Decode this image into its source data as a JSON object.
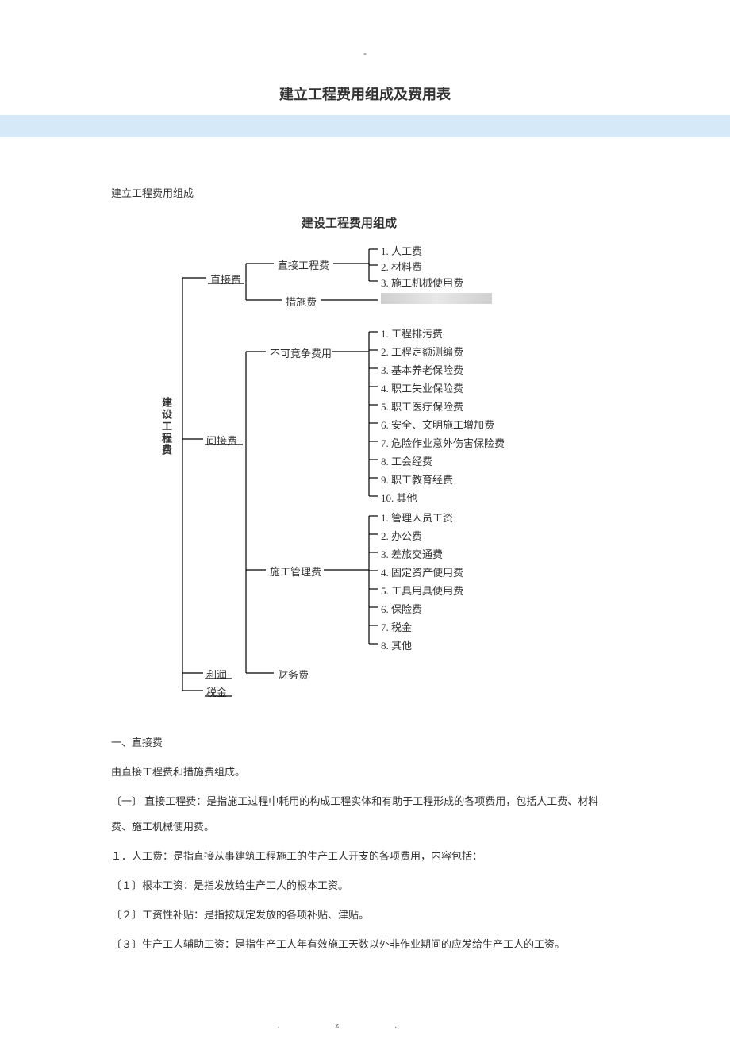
{
  "dash": "-",
  "title": "建立工程费用组成及费用表",
  "sub1": "建立工程费用组成",
  "diagram": {
    "heading": "建设工程费用组成",
    "root": "建设工程费",
    "branches": {
      "zhijie_fei": "直接费",
      "zhijie_gongcheng": "直接工程费",
      "cuoshi": "措施费",
      "jianjie": "间接费",
      "bukejing": "不可竞争费用",
      "shigong_guanli": "施工管理费",
      "caiwu": "财务费",
      "lirun": "利润",
      "shuijin": "税金"
    },
    "zhijie_items": [
      "1. 人工费",
      "2. 材料费",
      "3. 施工机械使用费"
    ],
    "bukejing_items": [
      "1. 工程排污费",
      "2. 工程定额测编费",
      "3. 基本养老保险费",
      "4. 职工失业保险费",
      "5. 职工医疗保险费",
      "6. 安全、文明施工增加费",
      "7. 危险作业意外伤害保险费",
      "8. 工会经费",
      "9. 职工教育经费",
      "10. 其他"
    ],
    "guanli_items": [
      "1. 管理人员工资",
      "2. 办公费",
      "3. 差旅交通费",
      "4. 固定资产使用费",
      "5. 工具用具使用费",
      "6. 保险费",
      "7. 税金",
      "8. 其他"
    ]
  },
  "body": {
    "h1": "一、直接费",
    "p1": "由直接工程费和措施费组成。",
    "p2": "〔一〕 直接工程费：是指施工过程中耗用的构成工程实体和有助于工程形成的各项费用，包括人工费、材料费、施工机械使用费。",
    "p3": "１．人工费：是指直接从事建筑工程施工的生产工人开支的各项费用，内容包括：",
    "p4": "〔１〕根本工资：是指发放给生产工人的根本工资。",
    "p5": "〔２〕工资性补贴：是指按规定发放的各项补贴、津贴。",
    "p6": "〔３〕生产工人辅助工资：是指生产工人年有效施工天数以外非作业期间的应发给生产工人的工资。"
  },
  "footer_dot": ".",
  "footer_z": "z."
}
